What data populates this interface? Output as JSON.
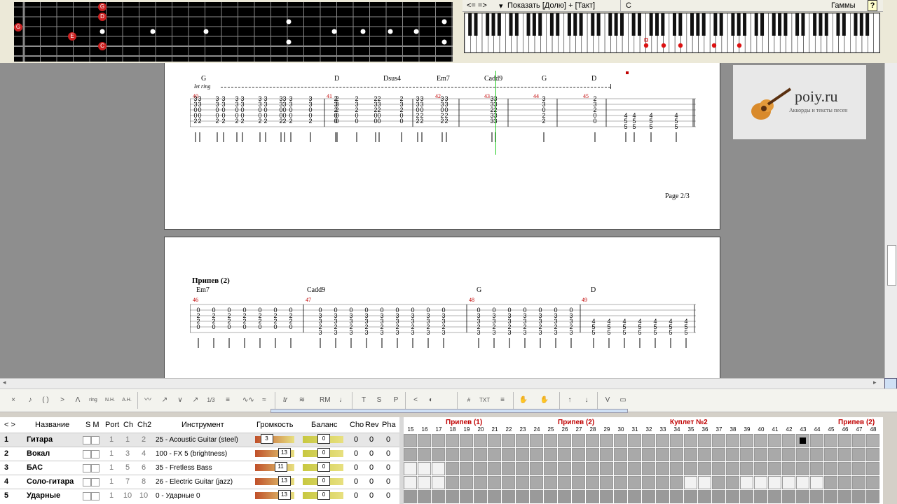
{
  "fretboard": {
    "markers": [
      {
        "label": "G",
        "color": "#cc2222"
      },
      {
        "label": "D",
        "color": "#cc2222"
      },
      {
        "label": "G",
        "color": "#cc2222"
      },
      {
        "label": "E",
        "color": "#cc2222"
      },
      {
        "label": "C",
        "color": "#cc2222"
      }
    ]
  },
  "piano": {
    "nav_arrows": "<= =>",
    "show_label": "Показать [Долю] + [Такт]",
    "chord_name": "C",
    "scales_label": "Гаммы",
    "help": "?"
  },
  "score": {
    "page_label": "Page 2/3",
    "let_ring": "let ring",
    "system1": {
      "chords": [
        "G",
        "D",
        "Dsus4",
        "Em7",
        "Cadd9",
        "G",
        "D"
      ],
      "bars": [
        "40",
        "41",
        "42",
        "43",
        "44",
        "45"
      ]
    },
    "system2": {
      "section": "Припев (2)",
      "chords": [
        "Em7",
        "Cadd9",
        "G",
        "D"
      ],
      "bars": [
        "46",
        "47",
        "48",
        "49"
      ]
    }
  },
  "ad": {
    "brand": "poiy.ru",
    "tagline": "Аккорды и тексты песен"
  },
  "toolbar": {
    "trill": "tr",
    "rm": "RM",
    "t": "T",
    "s": "S",
    "p": "P",
    "txt": "TXT",
    "vol": "V"
  },
  "tracks": {
    "headers": {
      "nav": "< >",
      "name": "Название",
      "sm": "S M",
      "port": "Port",
      "ch": "Ch",
      "ch2": "Ch2",
      "instrument": "Инструмент",
      "volume": "Громкость",
      "balance": "Баланс",
      "cho": "Cho",
      "rev": "Rev",
      "pha": "Pha"
    },
    "rows": [
      {
        "num": "1",
        "name": "Гитара",
        "port": "1",
        "ch": "1",
        "ch2": "2",
        "instrument": "25 - Acoustic Guitar (steel)",
        "volume": "3",
        "balance": "0",
        "cho": "0",
        "rev": "0",
        "pha": "0"
      },
      {
        "num": "2",
        "name": "Вокал",
        "port": "1",
        "ch": "3",
        "ch2": "4",
        "instrument": "100 - FX 5 (brightness)",
        "volume": "13",
        "balance": "0",
        "cho": "0",
        "rev": "0",
        "pha": "0"
      },
      {
        "num": "3",
        "name": "БАС",
        "port": "1",
        "ch": "5",
        "ch2": "6",
        "instrument": "35 - Fretless Bass",
        "volume": "11",
        "balance": "0",
        "cho": "0",
        "rev": "0",
        "pha": "0"
      },
      {
        "num": "4",
        "name": "Соло-гитара",
        "port": "1",
        "ch": "7",
        "ch2": "8",
        "instrument": "26 - Electric Guitar (jazz)",
        "volume": "13",
        "balance": "0",
        "cho": "0",
        "rev": "0",
        "pha": "0"
      },
      {
        "num": "5",
        "name": "Ударные",
        "port": "1",
        "ch": "10",
        "ch2": "10",
        "instrument": "0 - Ударные 0",
        "volume": "13",
        "balance": "0",
        "cho": "0",
        "rev": "0",
        "pha": "0"
      }
    ]
  },
  "timeline": {
    "markers": [
      "Припев (1)",
      "Припев (2)",
      "Куплет №2",
      "Припев (2)"
    ],
    "bars": [
      "15",
      "16",
      "17",
      "18",
      "19",
      "20",
      "21",
      "22",
      "23",
      "24",
      "25",
      "26",
      "27",
      "28",
      "29",
      "30",
      "31",
      "32",
      "33",
      "34",
      "35",
      "36",
      "37",
      "38",
      "39",
      "40",
      "41",
      "42",
      "43",
      "44",
      "45",
      "46",
      "47",
      "48"
    ]
  },
  "colors": {
    "accent": "#c00000",
    "cursor": "#22cc22"
  }
}
